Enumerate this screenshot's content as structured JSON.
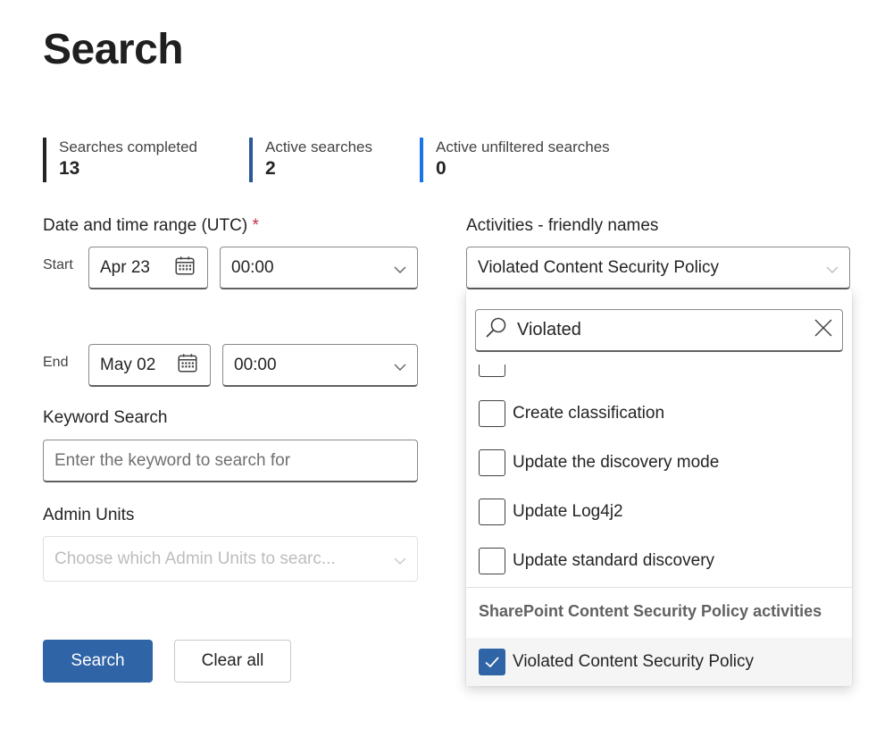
{
  "page": {
    "title": "Search"
  },
  "stats": [
    {
      "label": "Searches completed",
      "value": "13",
      "color": "#242424"
    },
    {
      "label": "Active searches",
      "value": "2",
      "color": "#2b5797"
    },
    {
      "label": "Active unfiltered searches",
      "value": "0",
      "color": "#1a73e8"
    }
  ],
  "date_range": {
    "label": "Date and time range (UTC)",
    "required_mark": "*",
    "start_label": "Start",
    "start_date": "Apr 23",
    "start_time": "00:00",
    "end_label": "End",
    "end_date": "May 02",
    "end_time": "00:00"
  },
  "keyword": {
    "label": "Keyword Search",
    "placeholder": "Enter the keyword to search for"
  },
  "admin_units": {
    "label": "Admin Units",
    "placeholder": "Choose which Admin Units to searc..."
  },
  "buttons": {
    "search": "Search",
    "clear": "Clear all"
  },
  "activities": {
    "label": "Activities - friendly names",
    "selected_value": "Violated Content Security Policy",
    "search_value": "Violated",
    "options": [
      {
        "label": "Create classification",
        "checked": false
      },
      {
        "label": "Update the discovery mode",
        "checked": false
      },
      {
        "label": "Update Log4j2",
        "checked": false
      },
      {
        "label": "Update standard discovery",
        "checked": false
      }
    ],
    "group_header": "SharePoint Content Security Policy activities",
    "group_options": [
      {
        "label": "Violated Content Security Policy",
        "checked": true
      }
    ]
  },
  "colors": {
    "primary": "#2f64a7",
    "required": "#c4314b"
  }
}
